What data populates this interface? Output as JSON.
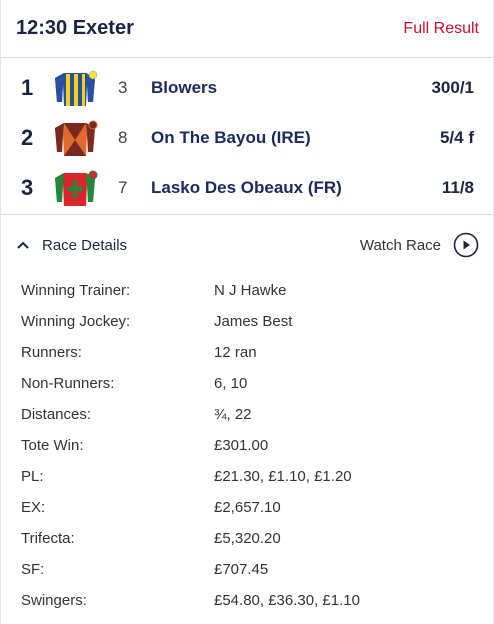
{
  "header": {
    "title": "12:30 Exeter",
    "full_result_label": "Full Result"
  },
  "runners": [
    {
      "position": "1",
      "number": "3",
      "name": "Blowers",
      "odds": "300/1",
      "silk": "yellow-blue-stripes-silk-icon"
    },
    {
      "position": "2",
      "number": "8",
      "name": "On The Bayou (IRE)",
      "odds": "5/4 f",
      "silk": "brown-orange-silk-icon"
    },
    {
      "position": "3",
      "number": "7",
      "name": "Lasko Des Obeaux (FR)",
      "odds": "11/8",
      "silk": "red-green-cross-silk-icon"
    }
  ],
  "race_details": {
    "toggle_label": "Race Details",
    "watch_label": "Watch Race",
    "rows": [
      {
        "label": "Winning Trainer:",
        "value": "N J Hawke"
      },
      {
        "label": "Winning Jockey:",
        "value": "James Best"
      },
      {
        "label": "Runners:",
        "value": "12 ran"
      },
      {
        "label": "Non-Runners:",
        "value": "6, 10"
      },
      {
        "label": "Distances:",
        "value": "¾, 22"
      },
      {
        "label": "Tote Win:",
        "value": "£301.00"
      },
      {
        "label": "PL:",
        "value": "£21.30, £1.10, £1.20"
      },
      {
        "label": "EX:",
        "value": "£2,657.10"
      },
      {
        "label": "Trifecta:",
        "value": "£5,320.20"
      },
      {
        "label": "SF:",
        "value": "£707.45"
      },
      {
        "label": "Swingers:",
        "value": "£54.80, £36.30, £1.10"
      }
    ]
  },
  "colors": {
    "accent_red": "#c8102e",
    "navy": "#1b2540",
    "link_navy": "#1b2a5e"
  }
}
